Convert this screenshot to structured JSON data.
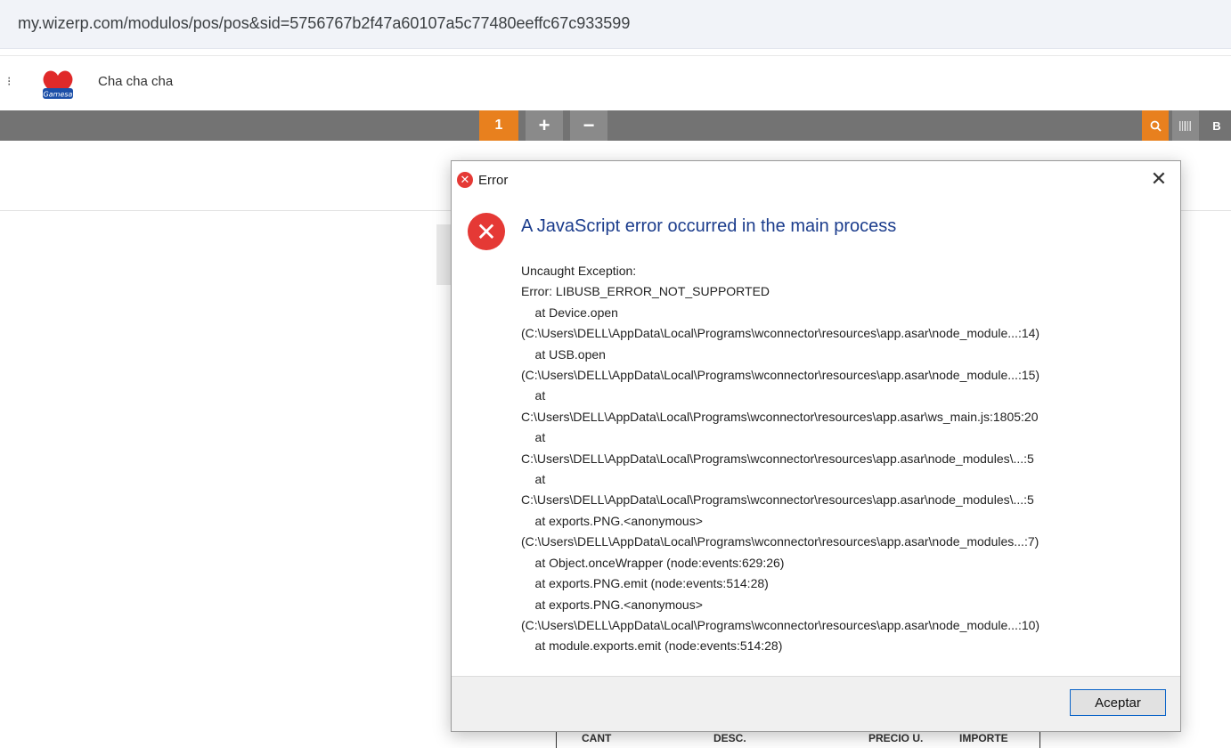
{
  "browser": {
    "url": "my.wizerp.com/modulos/pos/pos&sid=5756767b2f47a60107a5c77480eeffc67c933599",
    "bookmark_label": "Cha cha cha",
    "logo_text": "Gamesa"
  },
  "toolbar": {
    "tab_number": "1",
    "plus": "+",
    "minus": "−",
    "b_label": "B"
  },
  "dialog": {
    "title": "Error",
    "heading": "A JavaScript error occurred in the main process",
    "message_lines": [
      "Uncaught Exception:",
      "Error: LIBUSB_ERROR_NOT_SUPPORTED",
      "    at Device.open",
      "(C:\\Users\\DELL\\AppData\\Local\\Programs\\wconnector\\resources\\app.asar\\node_module...:14)",
      "    at USB.open",
      "(C:\\Users\\DELL\\AppData\\Local\\Programs\\wconnector\\resources\\app.asar\\node_module...:15)",
      "    at",
      "C:\\Users\\DELL\\AppData\\Local\\Programs\\wconnector\\resources\\app.asar\\ws_main.js:1805:20",
      "    at",
      "C:\\Users\\DELL\\AppData\\Local\\Programs\\wconnector\\resources\\app.asar\\node_modules\\...:5",
      "    at",
      "C:\\Users\\DELL\\AppData\\Local\\Programs\\wconnector\\resources\\app.asar\\node_modules\\...:5",
      "    at exports.PNG.<anonymous>",
      "(C:\\Users\\DELL\\AppData\\Local\\Programs\\wconnector\\resources\\app.asar\\node_modules...:7)",
      "    at Object.onceWrapper (node:events:629:26)",
      "    at exports.PNG.emit (node:events:514:28)",
      "    at exports.PNG.<anonymous>",
      "(C:\\Users\\DELL\\AppData\\Local\\Programs\\wconnector\\resources\\app.asar\\node_module...:10)",
      "    at module.exports.emit (node:events:514:28)"
    ],
    "ok_label": "Aceptar"
  },
  "table": {
    "headers": [
      "CANT",
      "DESC.",
      "PRECIO U.",
      "IMPORTE"
    ]
  },
  "colors": {
    "accent_orange": "#e8801e",
    "error_red": "#e53935",
    "heading_blue": "#1b3c8c"
  }
}
